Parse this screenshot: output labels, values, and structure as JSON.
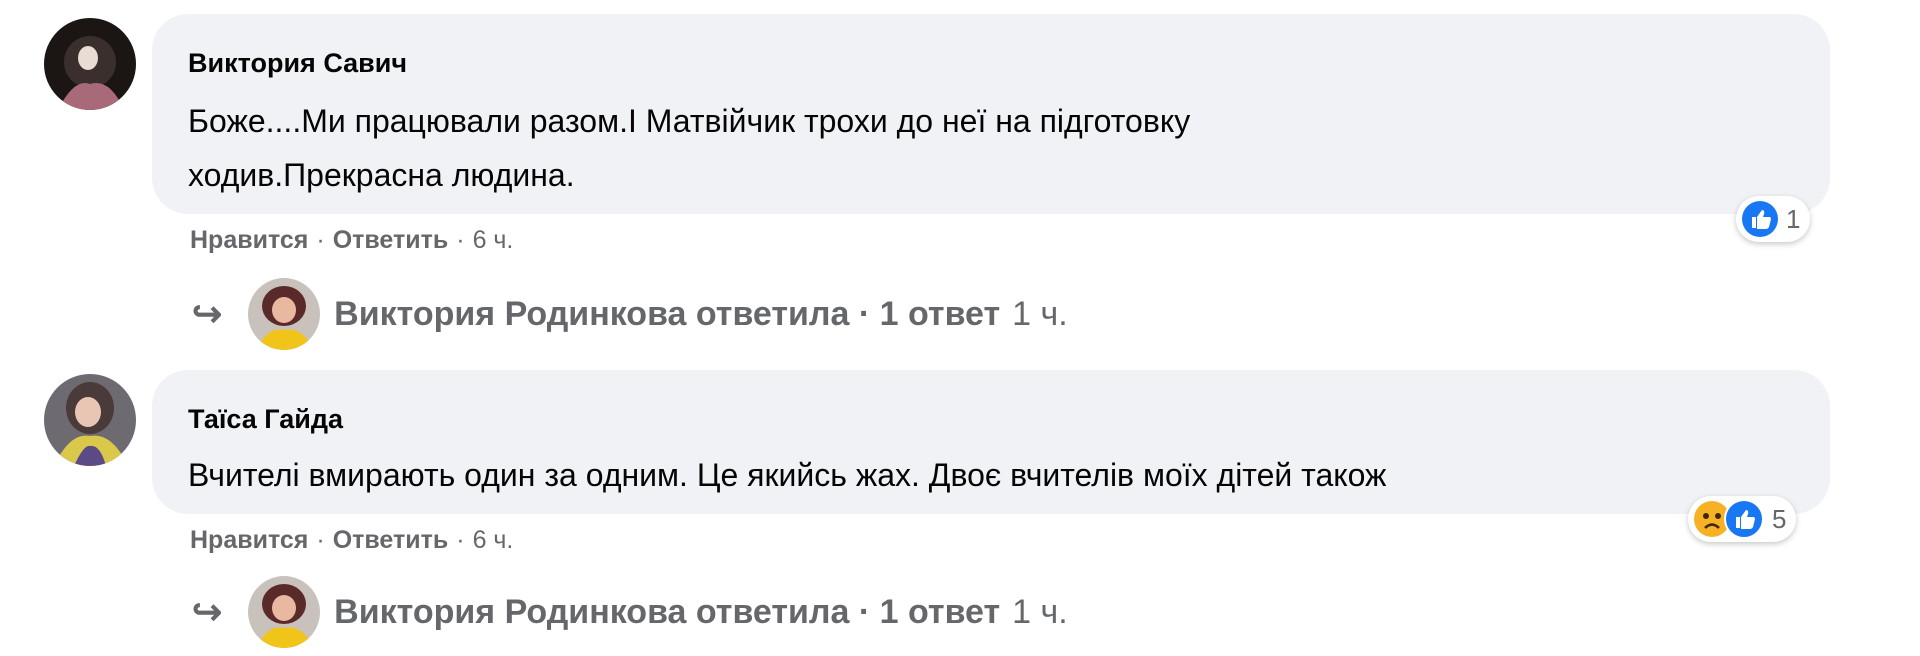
{
  "comments": [
    {
      "author": "Виктория Савич",
      "text_lines": [
        "Боже....Ми працювали разом.І Матвійчик трохи до неї на підготовку",
        "ходив.Прекрасна людина."
      ],
      "like_label": "Нравится",
      "reply_label": "Ответить",
      "time": "6 ч.",
      "reactions": {
        "icons": [
          "like-icon"
        ],
        "count": "1"
      },
      "reply_summary": {
        "text": "Виктория Родинкова ответила · 1 ответ",
        "time": "1 ч."
      }
    },
    {
      "author": "Таїса Гайда",
      "text_lines": [
        "Вчителі вмирають один за одним. Це якийсь жах. Двоє вчителів моїх дітей також"
      ],
      "like_label": "Нравится",
      "reply_label": "Ответить",
      "time": "6 ч.",
      "reactions": {
        "icons": [
          "sad-icon",
          "like-icon"
        ],
        "count": "5"
      },
      "reply_summary": {
        "text": "Виктория Родинкова ответила · 1 ответ",
        "time": "1 ч."
      }
    }
  ],
  "colors": {
    "bubble": "#f0f2f5",
    "meta": "#65676b",
    "like": "#1877f2",
    "sad": "#f7b125"
  }
}
